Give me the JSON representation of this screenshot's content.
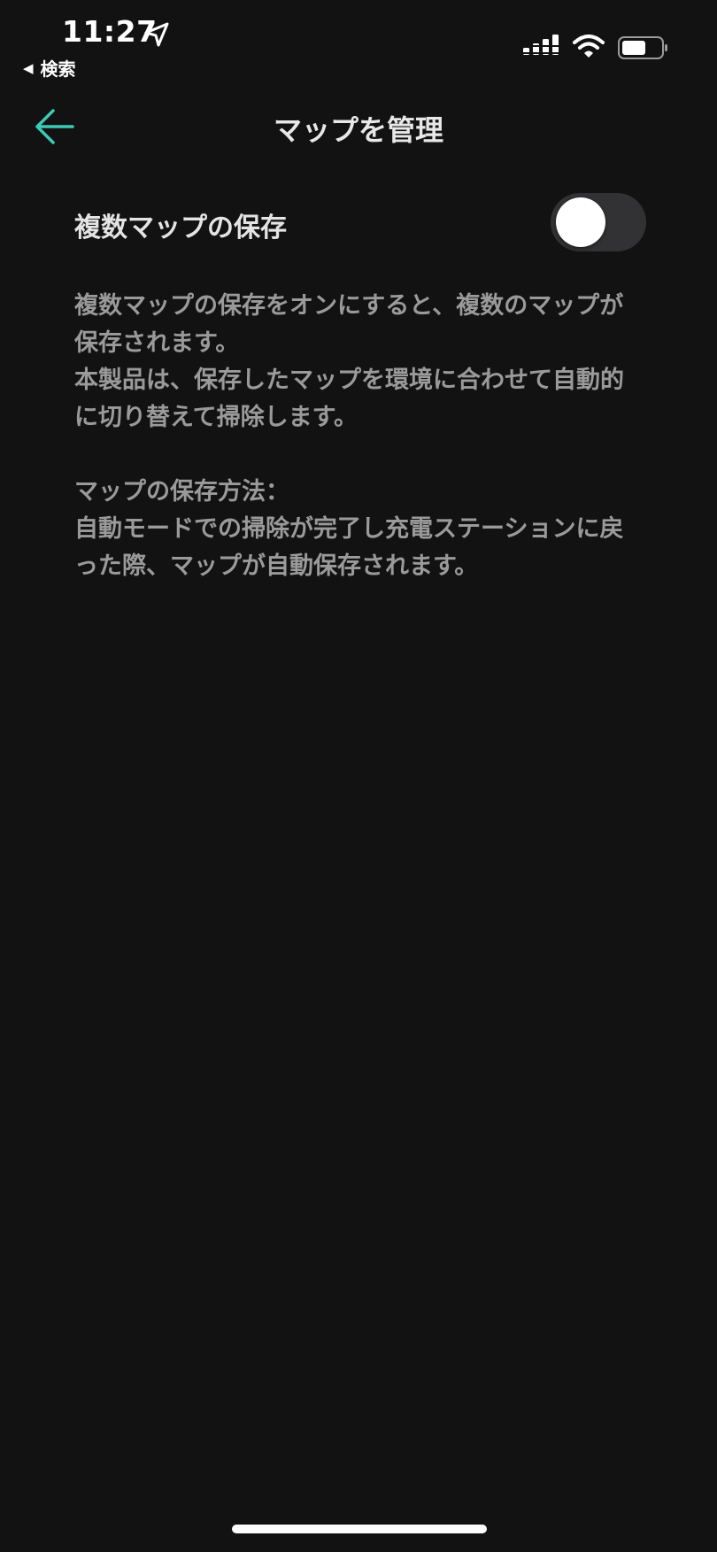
{
  "status_bar": {
    "time": "11:27",
    "back_to_app": "検索",
    "icons": [
      "location-arrow-icon",
      "signal-icon",
      "wifi-icon",
      "battery-icon"
    ],
    "battery_level_percent": 60
  },
  "header": {
    "title": "マップを管理",
    "back_icon": "back-arrow-icon"
  },
  "setting": {
    "label": "複数マップの保存",
    "toggle_state": "off"
  },
  "description": {
    "paragraph_1": "複数マップの保存をオンにすると、複数のマップが保存されます。",
    "paragraph_2": "本製品は、保存したマップを環境に合わせて自動的に切り替えて掃除します。",
    "heading": "マップの保存方法：",
    "paragraph_3": "自動モードでの掃除が完了し充電ステーションに戻った際、マップが自動保存されます。"
  },
  "colors": {
    "background": "#121212",
    "accent": "#3ec9b5",
    "toggle_off": "#323234",
    "secondary_text": "#9a9a9a"
  }
}
